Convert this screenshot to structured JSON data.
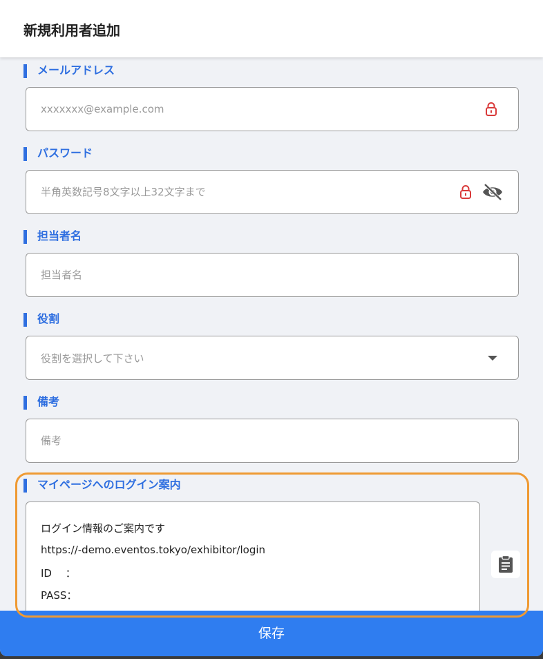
{
  "dialog": {
    "title": "新規利用者追加"
  },
  "email": {
    "label": "メールアドレス",
    "placeholder": "xxxxxxx@example.com",
    "icon": "lock-icon"
  },
  "password": {
    "label": "パスワード",
    "placeholder": "半角英数記号8文字以上32文字まで",
    "icons": [
      "lock-icon",
      "eye-off-icon"
    ]
  },
  "contact_name": {
    "label": "担当者名",
    "placeholder": "担当者名"
  },
  "role": {
    "label": "役割",
    "placeholder": "役割を選択して下さい"
  },
  "notes": {
    "label": "備考",
    "placeholder": "備考"
  },
  "login_guide": {
    "label": "マイページへのログイン案内",
    "lines": [
      "ログイン情報のご案内です",
      "https://-demo.eventos.tokyo/exhibitor/login",
      "ID　 ：",
      "PASS："
    ]
  },
  "save_label": "保存",
  "colors": {
    "accent": "#2f6fe0",
    "button": "#2f7df0",
    "lock": "#d93a3a",
    "highlight": "#ef9a33"
  }
}
